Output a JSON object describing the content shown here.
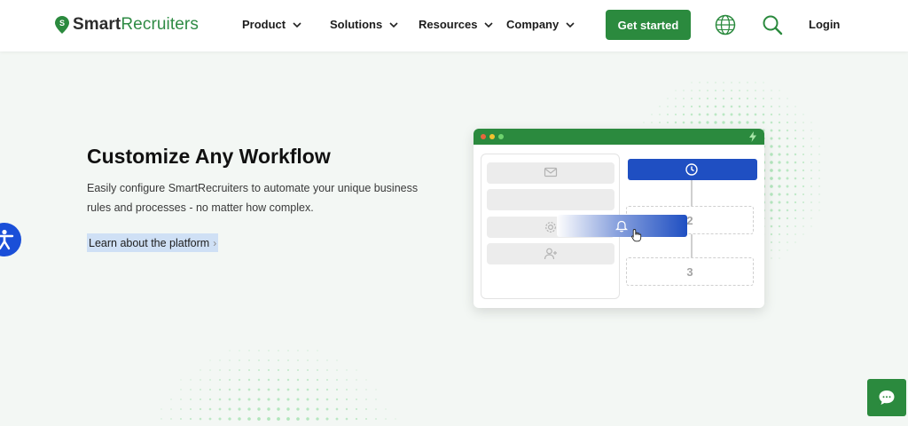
{
  "header": {
    "logo": {
      "part1": "Smart",
      "part2": "Recruiters",
      "icon": "logo-mark-icon"
    },
    "nav": [
      {
        "label": "Product"
      },
      {
        "label": "Solutions"
      },
      {
        "label": "Resources"
      },
      {
        "label": "Company"
      }
    ],
    "cta_label": "Get started",
    "globe_icon": "globe-icon",
    "search_icon": "search-icon",
    "login_label": "Login"
  },
  "hero": {
    "title": "Customize Any Workflow",
    "description": "Easily configure SmartRecruiters to automate your unique business rules and processes - no matter how complex.",
    "link_label": "Learn about the platform",
    "link_arrow": "›"
  },
  "illustration": {
    "step2": "2",
    "step3": "3",
    "icons": [
      "mail-icon",
      "gear-icon",
      "add-user-icon",
      "clock-icon",
      "bell-icon",
      "hand-cursor-icon",
      "bolt-icon"
    ]
  },
  "colors": {
    "brand_green": "#2b8a3e",
    "workflow_blue": "#1f4fc2",
    "accessibility_blue": "#1a4fd8",
    "link_highlight": "#cfe0f5"
  }
}
